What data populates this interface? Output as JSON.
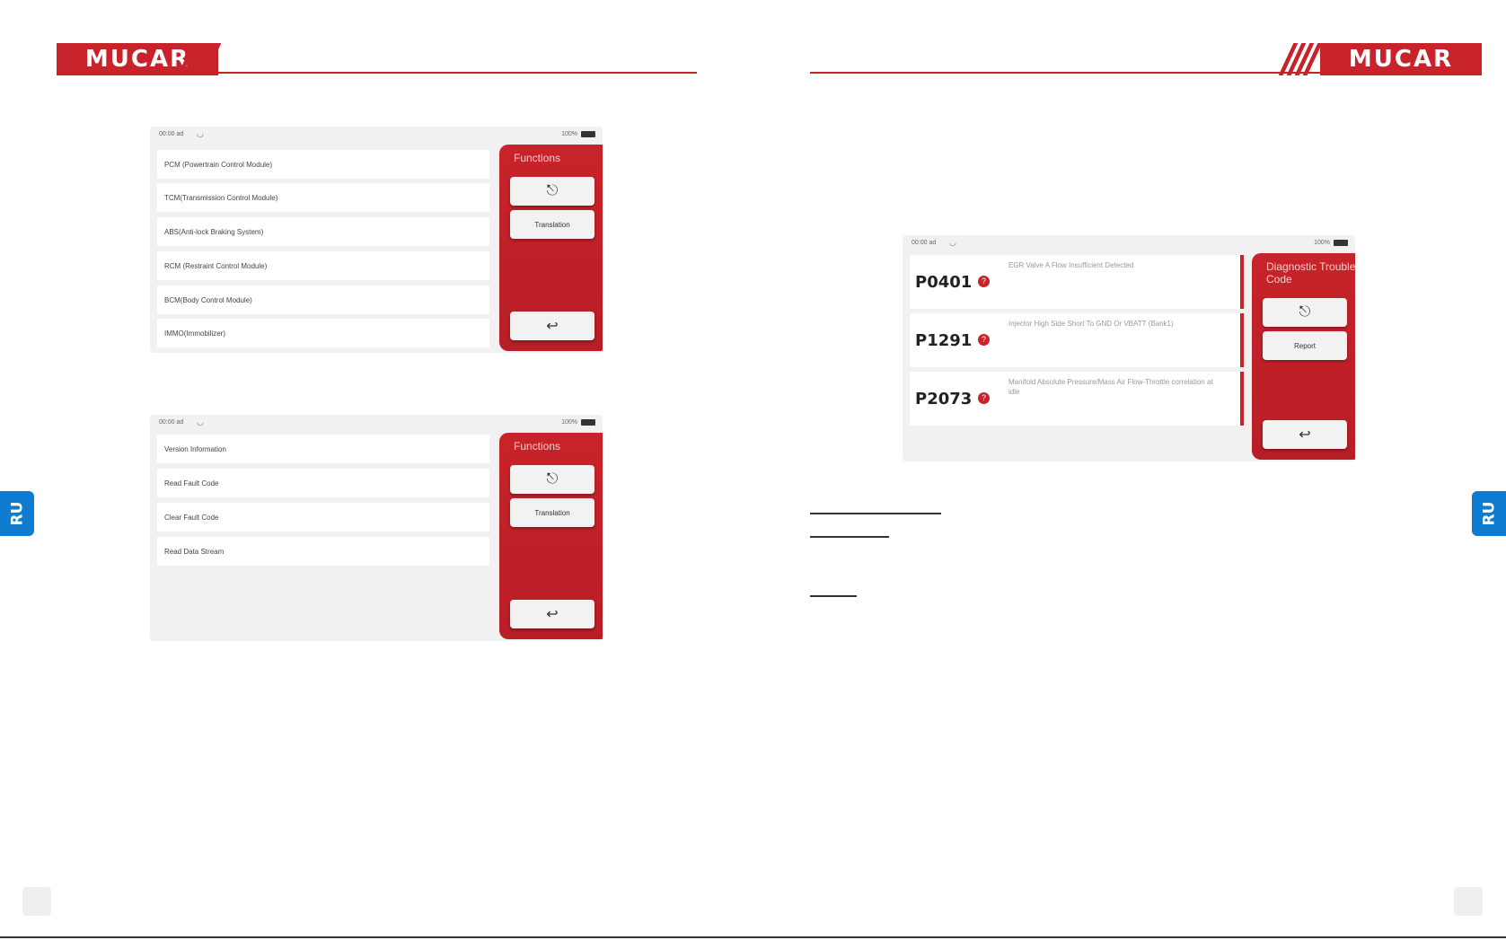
{
  "brand": {
    "logo_text": "MUCAR"
  },
  "lang_tab": "RU",
  "screen1": {
    "status": {
      "time": "00:00 ad",
      "battery": "100%"
    },
    "items": [
      "PCM (Powertrain Control Module)",
      "TCM(Transmission Control Module)",
      "ABS(Anti-lock Braking System)",
      "RCM (Restraint Control Module)",
      "BCM(Body Control Module)",
      "IMMO(Immobilizer)"
    ],
    "panel": {
      "title": "Functions",
      "translation_label": "Translation",
      "exit_icon": "⎋",
      "back_icon": "↩"
    }
  },
  "screen2": {
    "status": {
      "time": "00:00 ad",
      "battery": "100%"
    },
    "items": [
      "Version Information",
      "Read Fault Code",
      "Clear Fault Code",
      "Read Data Stream"
    ],
    "panel": {
      "title": "Functions",
      "translation_label": "Translation",
      "exit_icon": "⎋",
      "back_icon": "↩"
    }
  },
  "screen3": {
    "status": {
      "time": "00:00 ad",
      "battery": "100%"
    },
    "dtcs": [
      {
        "code": "P0401",
        "desc": "EGR Valve A Flow Insufficient Detected"
      },
      {
        "code": "P1291",
        "desc": "Injector High Side Short To GND Or VBATT (Bank1)"
      },
      {
        "code": "P2073",
        "desc": "Manifold Absolute Pressure/Mass Air Flow-Throttle correlation at idle"
      }
    ],
    "panel": {
      "title": "Diagnostic Trouble Code",
      "report_label": "Report",
      "exit_icon": "⎋",
      "back_icon": "↩"
    }
  },
  "colors": {
    "brand_red": "#c8232a",
    "tab_blue": "#0f7bd1"
  }
}
